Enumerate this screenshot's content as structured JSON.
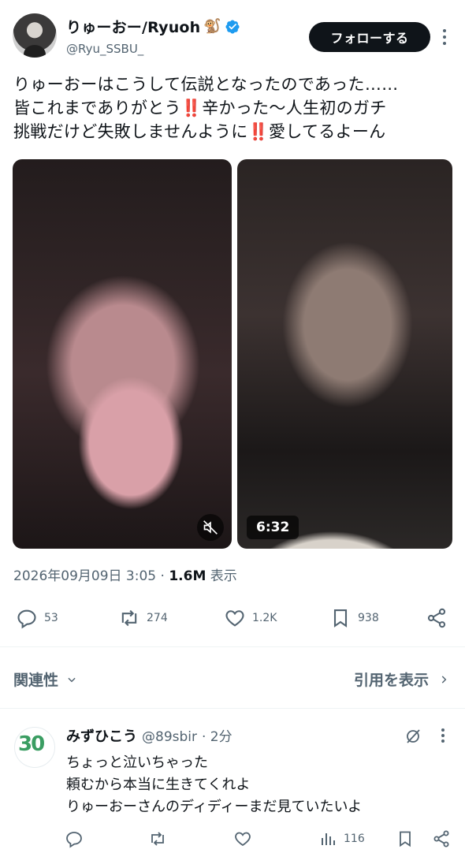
{
  "author": {
    "display_name": "りゅーおー/Ryuoh",
    "emoji": "🐒",
    "handle": "@Ryu_SSBU_",
    "verified": true
  },
  "follow_button": {
    "label": "フォローする"
  },
  "tweet": {
    "lines": [
      "りゅーおーはこうして伝説となったのであった……",
      "皆これまでありがとう‼️辛かった〜人生初のガチ",
      "挑戦だけど失敗しませんように‼️愛してるよーん"
    ]
  },
  "media": {
    "videos": [
      {
        "name": "video-1",
        "muted": true
      },
      {
        "name": "video-2",
        "duration": "6:32"
      }
    ]
  },
  "meta": {
    "timestamp": "2026年09月09日 3:05",
    "separator": "·",
    "views_count": "1.6M",
    "views_label": "表示"
  },
  "actions": {
    "replies": "53",
    "reposts": "274",
    "likes": "1.2K",
    "bookmarks": "938"
  },
  "related": {
    "label": "関連性",
    "quotes_link": "引用を表示"
  },
  "reply": {
    "display_name": "みずひこう",
    "handle": "@89sbir",
    "time": "· 2分",
    "avatar_text": "30",
    "lines": [
      "ちょっと泣いちゃった",
      "頼むから本当に生きてくれよ",
      "りゅーおーさんのディディーまだ見ていたいよ"
    ],
    "views": "116"
  },
  "colors": {
    "text_primary": "#0f1419",
    "text_secondary": "#536471",
    "verified_blue": "#1d9bf0",
    "follow_bg": "#0f1419",
    "divider": "#eff3f4"
  }
}
